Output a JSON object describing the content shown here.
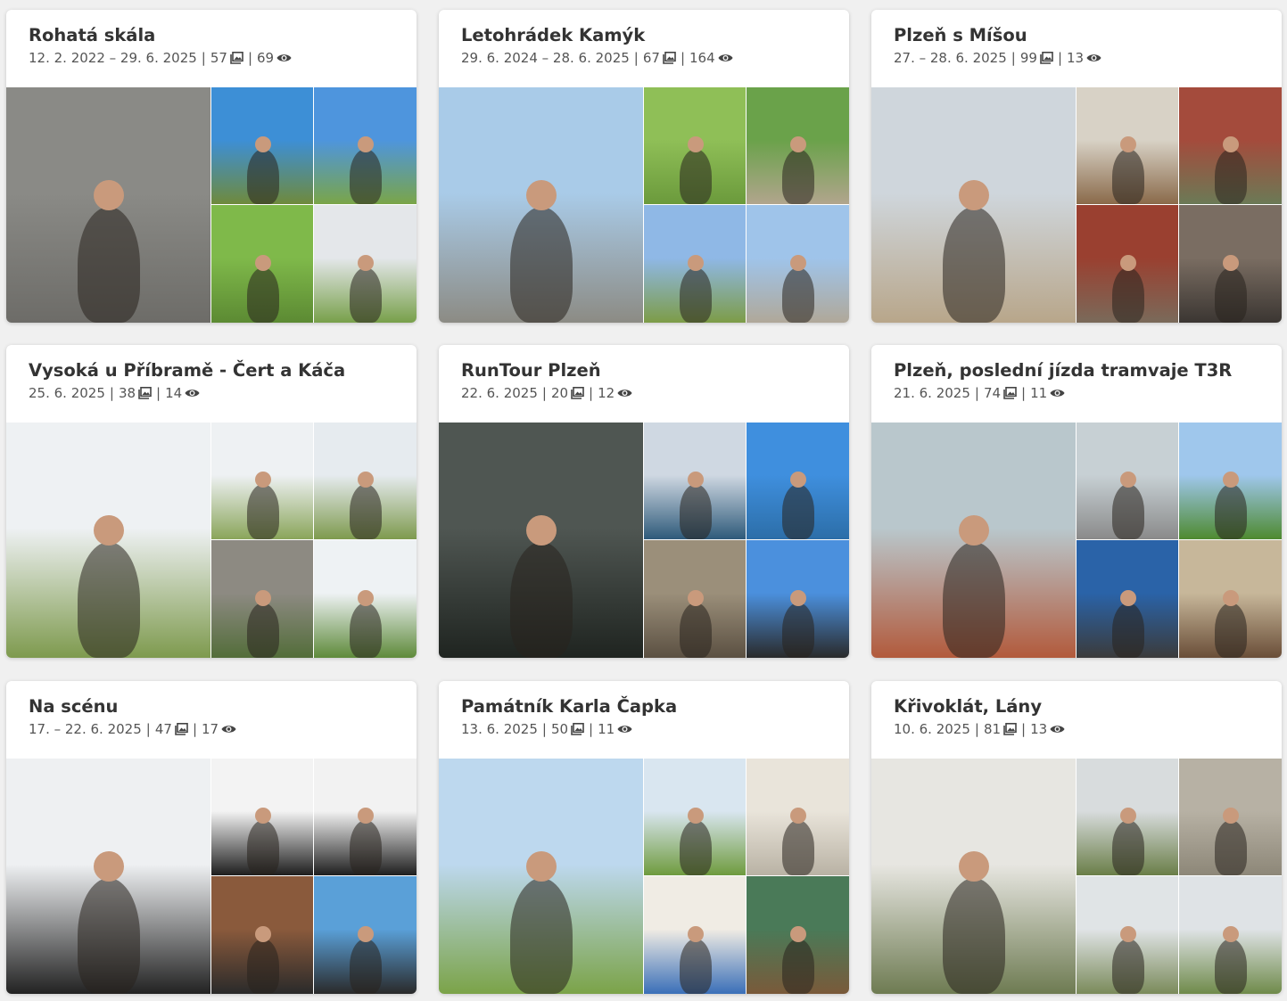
{
  "albums": [
    {
      "title": "Rohatá skála",
      "dates": "12. 2. 2022 – 29. 6. 2025",
      "photos": "57",
      "views": "69",
      "palette": [
        [
          "#8a8a86",
          "#6d6c68"
        ],
        [
          "#3d8fd6",
          "#6f8a3c"
        ],
        [
          "#4e95dd",
          "#7aa548"
        ],
        [
          "#7fb94a",
          "#5c8a33"
        ],
        [
          "#e4e7ea",
          "#78a04a"
        ]
      ]
    },
    {
      "title": "Letohrádek Kamýk",
      "dates": "29. 6. 2024 – 28. 6. 2025",
      "photos": "67",
      "views": "164",
      "palette": [
        [
          "#a9cbe8",
          "#8c8b84"
        ],
        [
          "#8fbf57",
          "#6b9a3c"
        ],
        [
          "#6aa24a",
          "#b1a58d"
        ],
        [
          "#8fb8e6",
          "#7d9c47"
        ],
        [
          "#9fc4ea",
          "#b0a899"
        ]
      ]
    },
    {
      "title": "Plzeň s Míšou",
      "dates": "27. – 28. 6. 2025",
      "photos": "99",
      "views": "13",
      "palette": [
        [
          "#cfd6dc",
          "#b8a68a"
        ],
        [
          "#d8d2c6",
          "#8a6a4a"
        ],
        [
          "#a44b3c",
          "#6b7a56"
        ],
        [
          "#9a4030",
          "#7a6a5a"
        ],
        [
          "#7a6d62",
          "#3b3632"
        ]
      ]
    },
    {
      "title": "Vysoká u Příbramě - Čert a Káča",
      "dates": "25. 6. 2025",
      "photos": "38",
      "views": "14",
      "palette": [
        [
          "#eef1f3",
          "#7e9a4e"
        ],
        [
          "#eef1f3",
          "#8aa55a"
        ],
        [
          "#e6ebef",
          "#7e9a4e"
        ],
        [
          "#8d8a82",
          "#536d3a"
        ],
        [
          "#eef2f4",
          "#5e8a3a"
        ]
      ]
    },
    {
      "title": "RunTour Plzeň",
      "dates": "22. 6. 2025",
      "photos": "20",
      "views": "12",
      "palette": [
        [
          "#4f5652",
          "#1f2420"
        ],
        [
          "#cfd8e2",
          "#2e5a7a"
        ],
        [
          "#3f8fde",
          "#2c6ea8"
        ],
        [
          "#9b8f7a",
          "#5b5042"
        ],
        [
          "#4b90dd",
          "#2a2a2a"
        ]
      ]
    },
    {
      "title": "Plzeň, poslední jízda tramvaje T3R",
      "dates": "21. 6. 2025",
      "photos": "74",
      "views": "11",
      "palette": [
        [
          "#b9c7cc",
          "#b25a3c"
        ],
        [
          "#c7d0d4",
          "#8a8a8a"
        ],
        [
          "#9fc7ec",
          "#4e8a30"
        ],
        [
          "#2a63a8",
          "#3b3b3b"
        ],
        [
          "#c7b79a",
          "#6a4e38"
        ]
      ]
    },
    {
      "title": "Na scénu",
      "dates": "17. – 22. 6. 2025",
      "photos": "47",
      "views": "17",
      "palette": [
        [
          "#eef0f2",
          "#222222"
        ],
        [
          "#f3f3f3",
          "#1e1e1e"
        ],
        [
          "#f2f2f2",
          "#1f1f1f"
        ],
        [
          "#8a5a3c",
          "#2a2a2a"
        ],
        [
          "#5aa0d8",
          "#2a2a2a"
        ]
      ]
    },
    {
      "title": "Památník Karla Čapka",
      "dates": "13. 6. 2025",
      "photos": "50",
      "views": "11",
      "palette": [
        [
          "#bdd8ee",
          "#7ba348"
        ],
        [
          "#d9e6f0",
          "#6f9b3e"
        ],
        [
          "#e9e4da",
          "#b9b2a4"
        ],
        [
          "#f0ece4",
          "#3a6fb8"
        ],
        [
          "#4a7a58",
          "#7a5a3a"
        ]
      ]
    },
    {
      "title": "Křivoklát, Lány",
      "dates": "10. 6. 2025",
      "photos": "81",
      "views": "13",
      "palette": [
        [
          "#e7e6e1",
          "#6e7b52"
        ],
        [
          "#d8dcdd",
          "#6a7e48"
        ],
        [
          "#b7b1a4",
          "#8d8778"
        ],
        [
          "#e0e4e6",
          "#7a8a5a"
        ],
        [
          "#dfe3e6",
          "#6f8a4a"
        ]
      ]
    }
  ]
}
